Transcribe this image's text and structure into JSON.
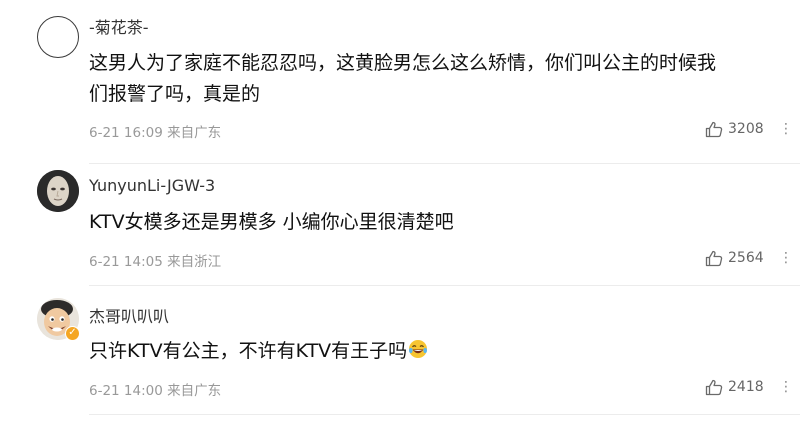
{
  "comments": [
    {
      "user": "-菊花茶-",
      "text_line1": "这男人为了家庭不能忍忍吗，这黄脸男怎么这么矫情，你们叫公主的时候我",
      "text_line2": "们报警了吗，真是的",
      "time": "6-21 16:09",
      "location": "来自广东",
      "likes": "3208",
      "avatar": "empty-circle"
    },
    {
      "user": "YunyunLi-JGW-3",
      "text_line1": "KTV女模多还是男模多 小编你心里很清楚吧",
      "time": "6-21 14:05",
      "location": "来自浙江",
      "likes": "2564",
      "avatar": "masked-face"
    },
    {
      "user": "杰哥叭叭叭",
      "text_line1": "只许KTV有公主，不许有KTV有王子吗",
      "time": "6-21 14:00",
      "location": "来自广东",
      "likes": "2418",
      "avatar": "cartoon-face-verified"
    }
  ],
  "icons": {
    "like": "thumbs-up-icon",
    "more": "more-dots-icon",
    "emoji": "laughing-tears-emoji"
  },
  "colors": {
    "text": "#111111",
    "username": "#333333",
    "meta": "#999999",
    "divider": "#ececec",
    "verified_badge": "#f5a623"
  }
}
